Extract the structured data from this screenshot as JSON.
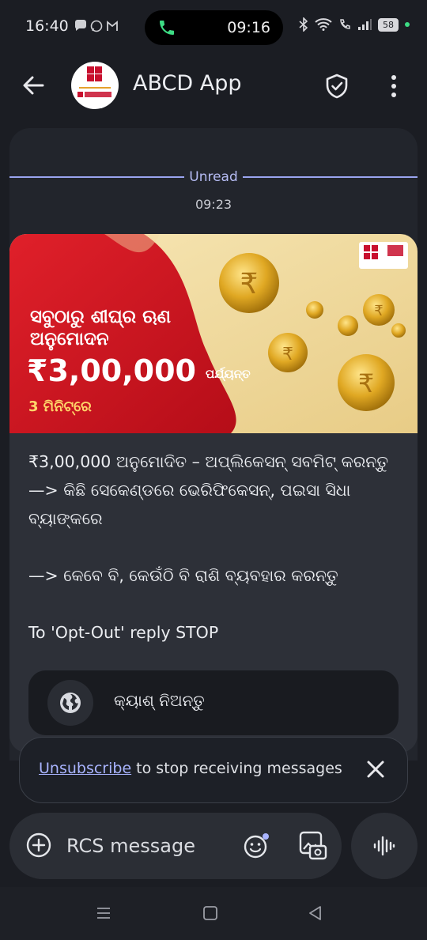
{
  "status_bar": {
    "time": "16:40",
    "notification_icons": [
      "chat-bubble-icon",
      "whatsapp-icon",
      "gmail-icon"
    ],
    "call_time": "09:16",
    "battery": "58",
    "right_icons": [
      "bluetooth-icon",
      "wifi-icon",
      "wifi-call-icon",
      "signal-icon",
      "battery-icon"
    ]
  },
  "app_bar": {
    "title": "ABCD App",
    "avatar_logo_text": "abcd",
    "avatar_sub_text": "ADITYA BIRLA CAPITAL"
  },
  "chat": {
    "unread_label": "Unread",
    "timestamp": "09:23",
    "banner": {
      "headline_line1": "ସବୁଠାରୁ ଶୀଘ୍ର ଋଣ",
      "headline_line2": "ଅନୁମୋଦନ",
      "amount": "₹3,00,000",
      "amount_suffix": "ପର୍ଯ୍ୟନ୍ତ",
      "duration": "3 ମିନିଟ୍‌ରେ",
      "logo_text": "abcd",
      "logo_brand": "ADITYA BIRLA CAPITAL",
      "background_colors": {
        "red": "#d0151f",
        "gold": "#f1dca0"
      }
    },
    "message_lines": "₹3,00,000 ଅନୁମୋଦିତ – ଅପ୍ଲିକେସନ୍ ସବମିଟ୍ କରନ୍ତୁ\n—> କିଛି ସେକେଣ୍ଡରେ ଭେରିଫିକେସନ୍, ପଇସା ସିଧା ବ୍ୟାଙ୍କରେ\n\n—> କେବେ ବି, କେଉଁଠି ବି ରାଶି ବ୍ୟବହାର କରନ୍ତୁ\n\nTo 'Opt-Out' reply STOP",
    "cta_label": "କ୍ୟାଶ୍ ନିଅନ୍ତୁ"
  },
  "toast": {
    "link_text": "Unsubscribe",
    "text": " to stop receiving messages"
  },
  "compose": {
    "placeholder": "RCS message"
  },
  "colors": {
    "background": "#1b1d23",
    "bubble": "#2d3038",
    "accent_link": "#a9b4ff",
    "unread_line": "#9aa4f0"
  }
}
